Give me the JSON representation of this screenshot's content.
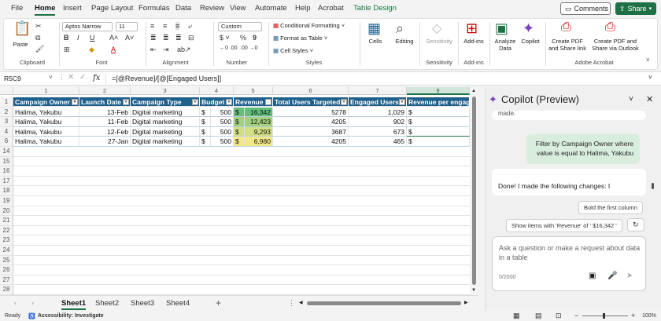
{
  "menu": {
    "items": [
      "File",
      "Home",
      "Insert",
      "Page Layout",
      "Formulas",
      "Data",
      "Review",
      "View",
      "Automate",
      "Help",
      "Acrobat",
      "Table Design"
    ],
    "active": "Home",
    "comments_label": "Comments",
    "share_label": "Share"
  },
  "ribbon": {
    "clipboard": {
      "paste": "Paste",
      "label": "Clipboard"
    },
    "font": {
      "name": "Aptos Narrow",
      "size": "11",
      "label": "Font"
    },
    "alignment": {
      "label": "Alignment"
    },
    "number": {
      "format": "Custom",
      "label": "Number"
    },
    "styles": {
      "conditional": "Conditional Formatting",
      "format_table": "Format as Table",
      "cell_styles": "Cell Styles",
      "label": "Styles"
    },
    "cells": {
      "label": "Cells"
    },
    "editing": {
      "label": "Editing"
    },
    "sensitivity": {
      "btn": "Sensitivity",
      "label": "Sensitivity"
    },
    "addins": {
      "btn": "Add-ins",
      "label": "Add-ins"
    },
    "analyze": {
      "btn1": "Analyze",
      "btn2": "Data"
    },
    "copilot_btn": "Copilot",
    "acrobat": {
      "btn1a": "Create PDF",
      "btn1b": "and Share link",
      "btn2a": "Create PDF and",
      "btn2b": "Share via Outlook",
      "label": "Adobe Acrobat"
    }
  },
  "formula_bar": {
    "name_box": "R5C9",
    "fx": "fx",
    "formula": "=[@Revenue]/[@[Engaged Users]]"
  },
  "sheet": {
    "column_numbers": [
      "1",
      "2",
      "3",
      "4",
      "5",
      "6",
      "7",
      "8",
      "9"
    ],
    "selected_column": "9",
    "headers": [
      "Campaign Owner",
      "Launch Date",
      "Campaign Type",
      "Budget",
      "Revenue",
      "Total Users Targeted",
      "Engaged Users",
      "Revenue per engage"
    ],
    "rows": [
      {
        "owner": "Halima, Yakubu",
        "date": "13-Feb",
        "type": "Digital marketing",
        "cur": "$",
        "budget": "500",
        "rcur": "$",
        "revenue": "16,342",
        "targeted": "5278",
        "engaged": "1,029",
        "rpe": "$",
        "color": "#63be7b"
      },
      {
        "owner": "Halima, Yakubu",
        "date": "11-Feb",
        "type": "Digital marketing",
        "cur": "$",
        "budget": "500",
        "rcur": "$",
        "revenue": "12,423",
        "targeted": "4205",
        "engaged": "902",
        "rpe": "$",
        "color": "#a2d07f"
      },
      {
        "owner": "Halima, Yakubu",
        "date": "12-Feb",
        "type": "Digital marketing",
        "cur": "$",
        "budget": "500",
        "rcur": "$",
        "revenue": "9,293",
        "targeted": "3687",
        "engaged": "673",
        "rpe": "$",
        "color": "#d3df82"
      },
      {
        "owner": "Halima, Yakubu",
        "date": "27-Jan",
        "type": "Digital marketing",
        "cur": "$",
        "budget": "500",
        "rcur": "$",
        "revenue": "6,980",
        "targeted": "4205",
        "engaged": "465",
        "rpe": "$",
        "color": "#f2e885"
      }
    ],
    "row_numbers": [
      "1",
      "2",
      "3",
      "4",
      "6",
      "14",
      "15",
      "16",
      "17",
      "18",
      "19",
      "20",
      "21",
      "22",
      "23",
      "24",
      "25",
      "26",
      "27",
      "28"
    ]
  },
  "sheet_tabs": [
    "Sheet1",
    "Sheet2",
    "Sheet3",
    "Sheet4"
  ],
  "active_tab": "Sheet1",
  "status": {
    "ready": "Ready",
    "accessibility": "Accessibility: Investigate",
    "zoom": "100%"
  },
  "copilot": {
    "title": "Copilot (Preview)",
    "prev_fragment": "made.",
    "user_msg": "Filter by Campaign Owner where value is equal to Halima, Yakubu",
    "reply": "Done! I made the following changes: I",
    "suggestion1": "Bold the first column",
    "suggestion2": "Show items with 'Revenue' of ' $16,342 '",
    "input_placeholder": "Ask a question or make a request about data in a table",
    "counter": "0/2000"
  }
}
